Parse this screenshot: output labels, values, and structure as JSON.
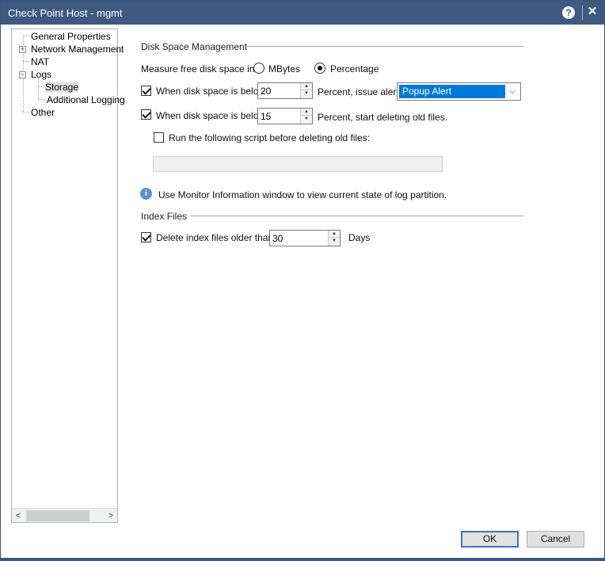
{
  "window": {
    "title": "Check Point Host - mgmt",
    "help_icon": "?",
    "close_icon": "✕"
  },
  "tree": {
    "items": [
      {
        "label": "General Properties",
        "expander": ""
      },
      {
        "label": "Network Management",
        "expander": "+"
      },
      {
        "label": "NAT",
        "expander": ""
      },
      {
        "label": "Logs",
        "expander": "−"
      },
      {
        "label": "Storage",
        "expander": ""
      },
      {
        "label": "Additional Logging",
        "expander": ""
      },
      {
        "label": "Other",
        "expander": ""
      }
    ],
    "selected": "Storage",
    "scroll_left": "<",
    "scroll_right": ">"
  },
  "disk_space": {
    "section_title": "Disk Space Management",
    "measure_label": "Measure free disk space in:",
    "option_mbytes": "MBytes",
    "option_percentage": "Percentage",
    "selected_measure": "Percentage",
    "alert_row": {
      "checked": true,
      "label": "When disk space is below",
      "value": "20",
      "suffix": "Percent, issue alert:",
      "alert_type": "Popup Alert"
    },
    "delete_row": {
      "checked": true,
      "label": "When disk space is below",
      "value": "15",
      "suffix": "Percent, start deleting old files."
    },
    "script_row": {
      "checked": false,
      "label": "Run the following script before deleting old files:",
      "script_value": ""
    },
    "info_text": "Use Monitor Information window to view current state of log partition."
  },
  "index_files": {
    "section_title": "Index Files",
    "delete_row": {
      "checked": true,
      "label": "Delete index files older than",
      "value": "30",
      "suffix": "Days"
    }
  },
  "buttons": {
    "ok": "OK",
    "cancel": "Cancel"
  }
}
